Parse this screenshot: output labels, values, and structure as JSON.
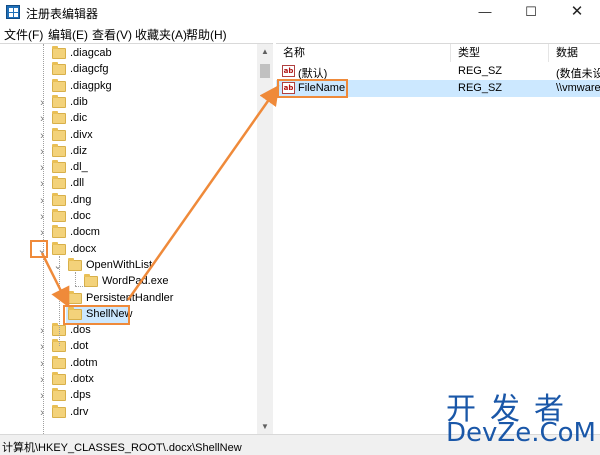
{
  "window": {
    "title": "注册表编辑器",
    "minimize_glyph": "—",
    "maximize_glyph": "☐",
    "close_glyph": "✕"
  },
  "menu": {
    "items": [
      "文件(F)",
      "编辑(E)",
      "查看(V)",
      "收藏夹(A)",
      "帮助(H)"
    ]
  },
  "tree": {
    "items": [
      {
        "label": ".diagcab",
        "expander": ""
      },
      {
        "label": ".diagcfg",
        "expander": ""
      },
      {
        "label": ".diagpkg",
        "expander": ""
      },
      {
        "label": ".dib",
        "expander": ">"
      },
      {
        "label": ".dic",
        "expander": ">"
      },
      {
        "label": ".divx",
        "expander": ">"
      },
      {
        "label": ".diz",
        "expander": ">"
      },
      {
        "label": ".dl_",
        "expander": ">"
      },
      {
        "label": ".dll",
        "expander": ">"
      },
      {
        "label": ".dng",
        "expander": ">"
      },
      {
        "label": ".doc",
        "expander": ">"
      },
      {
        "label": ".docm",
        "expander": ">"
      },
      {
        "label": ".docx",
        "expander": "v"
      },
      {
        "label": "OpenWithList",
        "expander": "v"
      },
      {
        "label": "WordPad.exe",
        "expander": ""
      },
      {
        "label": "PersistentHandler",
        "expander": ""
      },
      {
        "label": "ShellNew",
        "expander": ""
      },
      {
        "label": ".dos",
        "expander": ">"
      },
      {
        "label": ".dot",
        "expander": ">"
      },
      {
        "label": ".dotm",
        "expander": ">"
      },
      {
        "label": ".dotx",
        "expander": ">"
      },
      {
        "label": ".dps",
        "expander": ">"
      },
      {
        "label": ".drv",
        "expander": ">"
      }
    ],
    "selected": "ShellNew"
  },
  "values": {
    "columns": [
      "名称",
      "类型",
      "数据"
    ],
    "rows": [
      {
        "name": "(默认)",
        "type": "REG_SZ",
        "data": "(数值未设"
      },
      {
        "name": "FileName",
        "type": "REG_SZ",
        "data": "\\\\vmware"
      }
    ],
    "selected": "FileName"
  },
  "status": {
    "path": "计算机\\HKEY_CLASSES_ROOT\\.docx\\ShellNew"
  },
  "watermark": {
    "line1": "开发者",
    "line2": "DevZe.CoM"
  },
  "colors": {
    "accent_orange": "#ef8a3a",
    "selection": "#cce8ff",
    "folder": "#f3d27a",
    "watermark_blue": "#1a57a8"
  }
}
